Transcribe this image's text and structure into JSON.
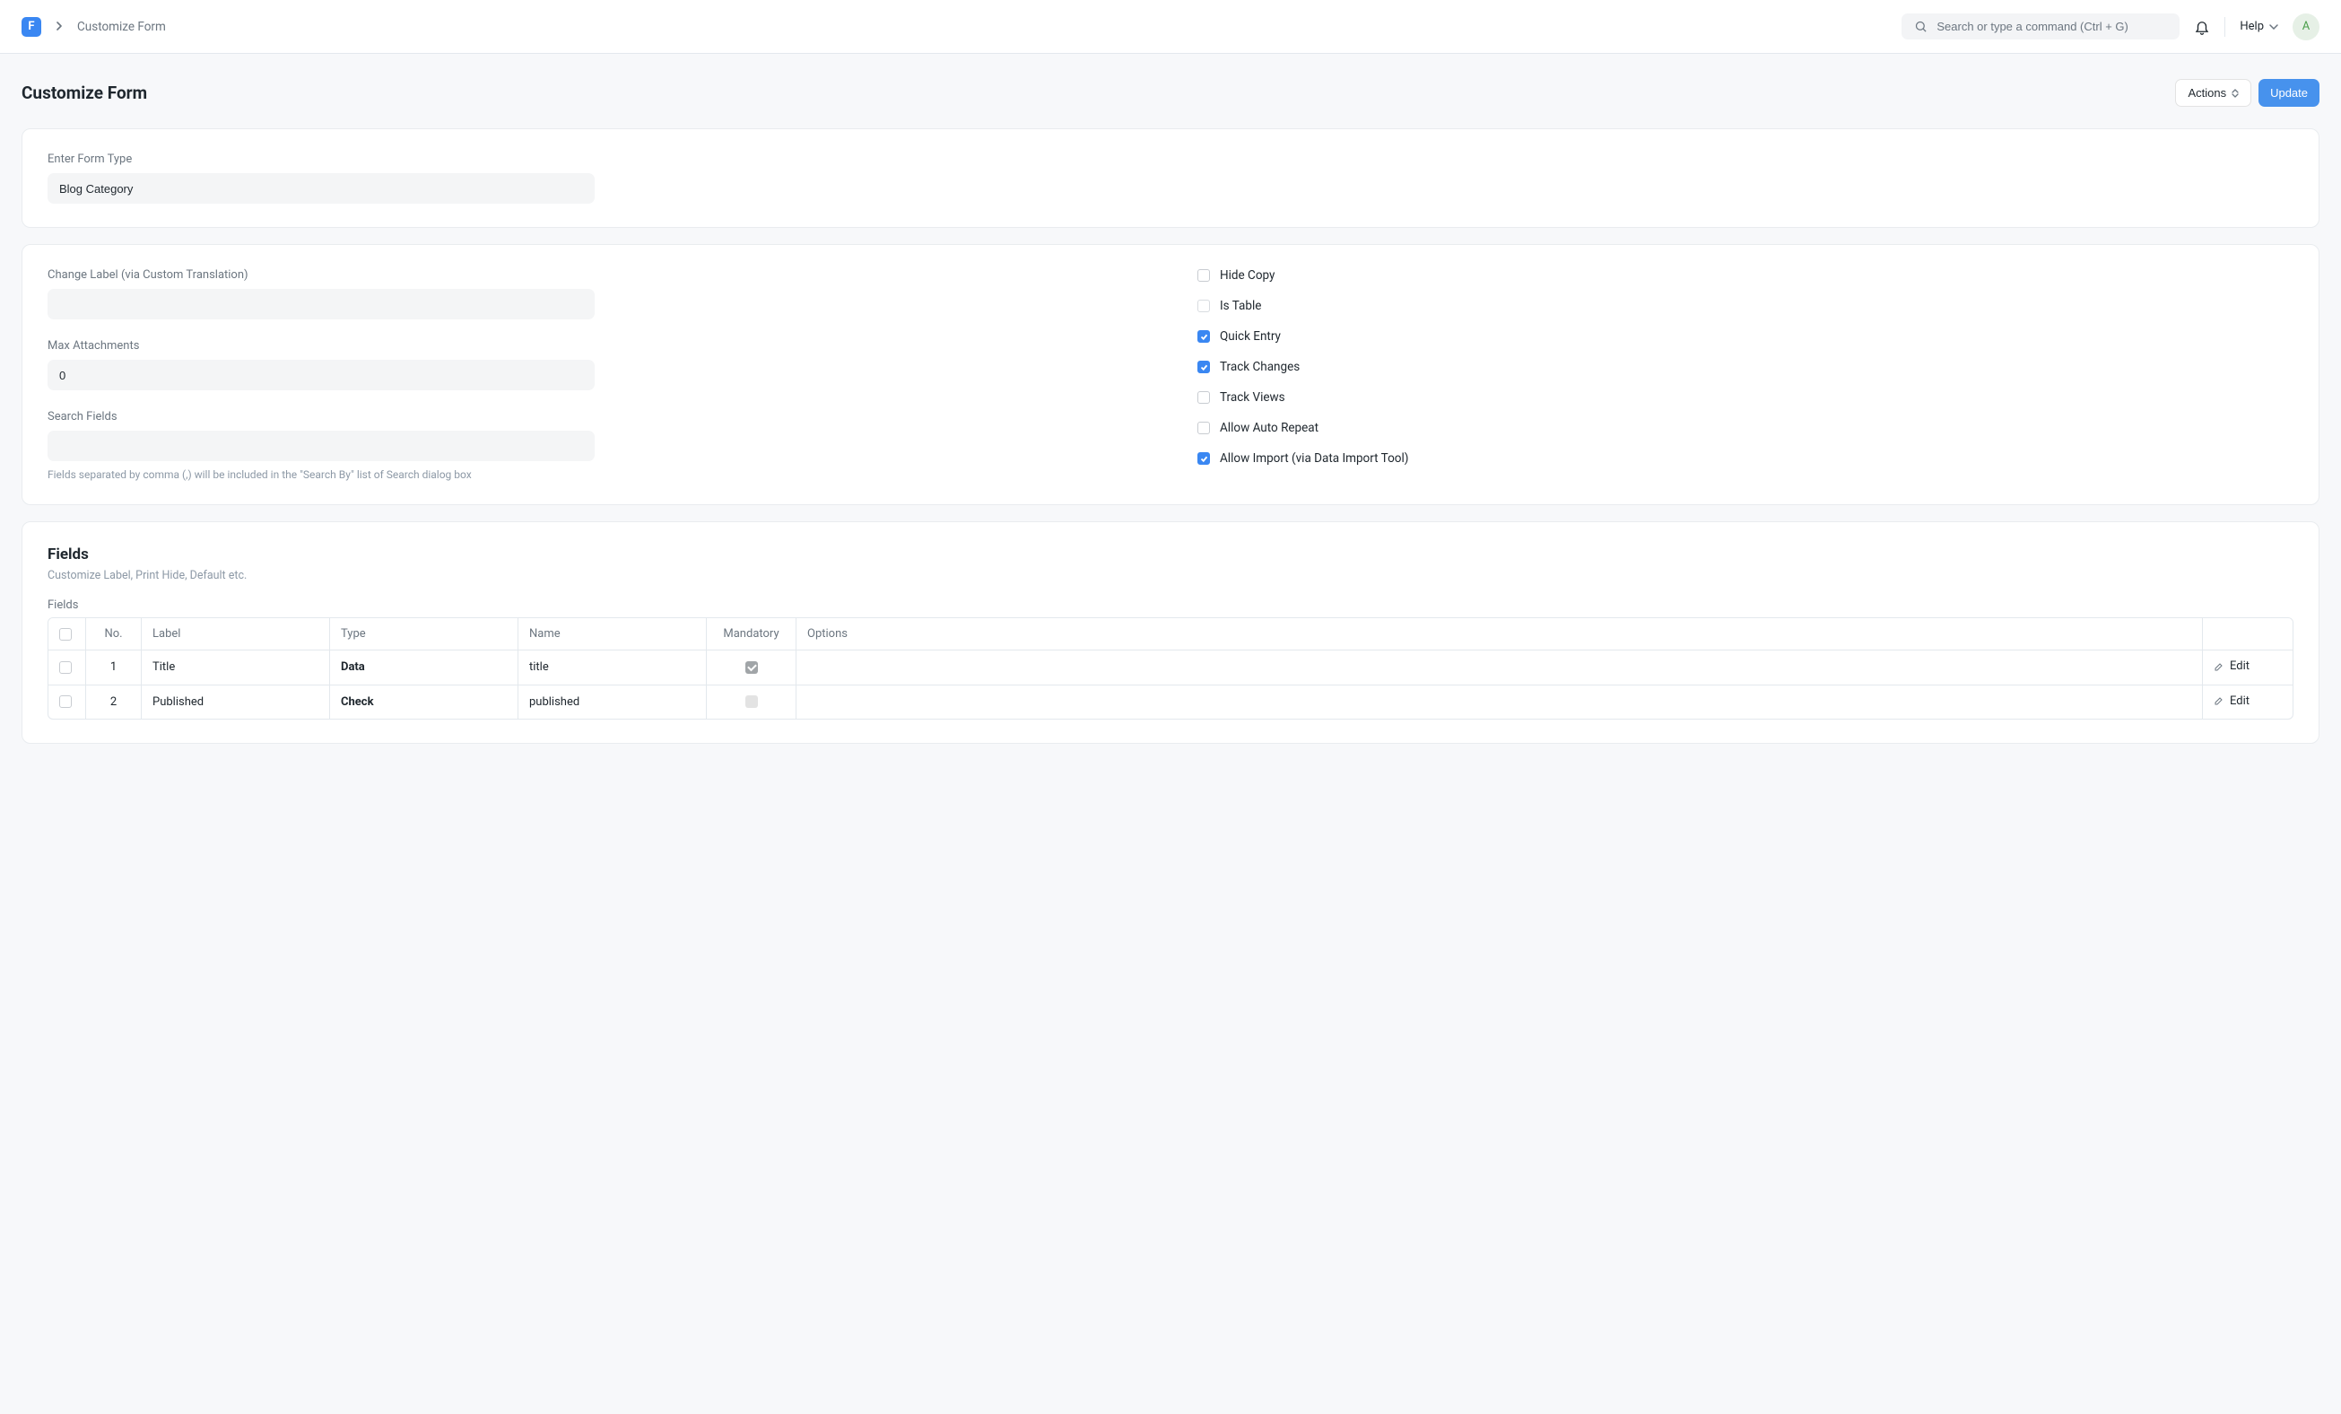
{
  "header": {
    "logo_letter": "F",
    "breadcrumb_current": "Customize Form",
    "search_placeholder": "Search or type a command (Ctrl + G)",
    "help_label": "Help",
    "avatar_letter": "A"
  },
  "page": {
    "title": "Customize Form",
    "actions_label": "Actions",
    "update_label": "Update"
  },
  "form_type": {
    "label": "Enter Form Type",
    "value": "Blog Category"
  },
  "settings": {
    "change_label": {
      "label": "Change Label (via Custom Translation)",
      "value": ""
    },
    "max_attachments": {
      "label": "Max Attachments",
      "value": "0"
    },
    "search_fields": {
      "label": "Search Fields",
      "value": "",
      "help": "Fields separated by comma (,) will be included in the \"Search By\" list of Search dialog box"
    }
  },
  "checks": [
    {
      "label": "Hide Copy",
      "checked": false,
      "disabled": false
    },
    {
      "label": "Is Table",
      "checked": false,
      "disabled": true
    },
    {
      "label": "Quick Entry",
      "checked": true,
      "disabled": false
    },
    {
      "label": "Track Changes",
      "checked": true,
      "disabled": false
    },
    {
      "label": "Track Views",
      "checked": false,
      "disabled": false
    },
    {
      "label": "Allow Auto Repeat",
      "checked": false,
      "disabled": false
    },
    {
      "label": "Allow Import (via Data Import Tool)",
      "checked": true,
      "disabled": false
    }
  ],
  "fields_section": {
    "title": "Fields",
    "subtitle": "Customize Label, Print Hide, Default etc.",
    "table_label": "Fields",
    "columns": {
      "no": "No.",
      "label": "Label",
      "type": "Type",
      "name": "Name",
      "mandatory": "Mandatory",
      "options": "Options",
      "edit": "Edit"
    },
    "rows": [
      {
        "no": "1",
        "label": "Title",
        "type": "Data",
        "name": "title",
        "mandatory": true,
        "options": ""
      },
      {
        "no": "2",
        "label": "Published",
        "type": "Check",
        "name": "published",
        "mandatory": false,
        "options": ""
      }
    ]
  }
}
